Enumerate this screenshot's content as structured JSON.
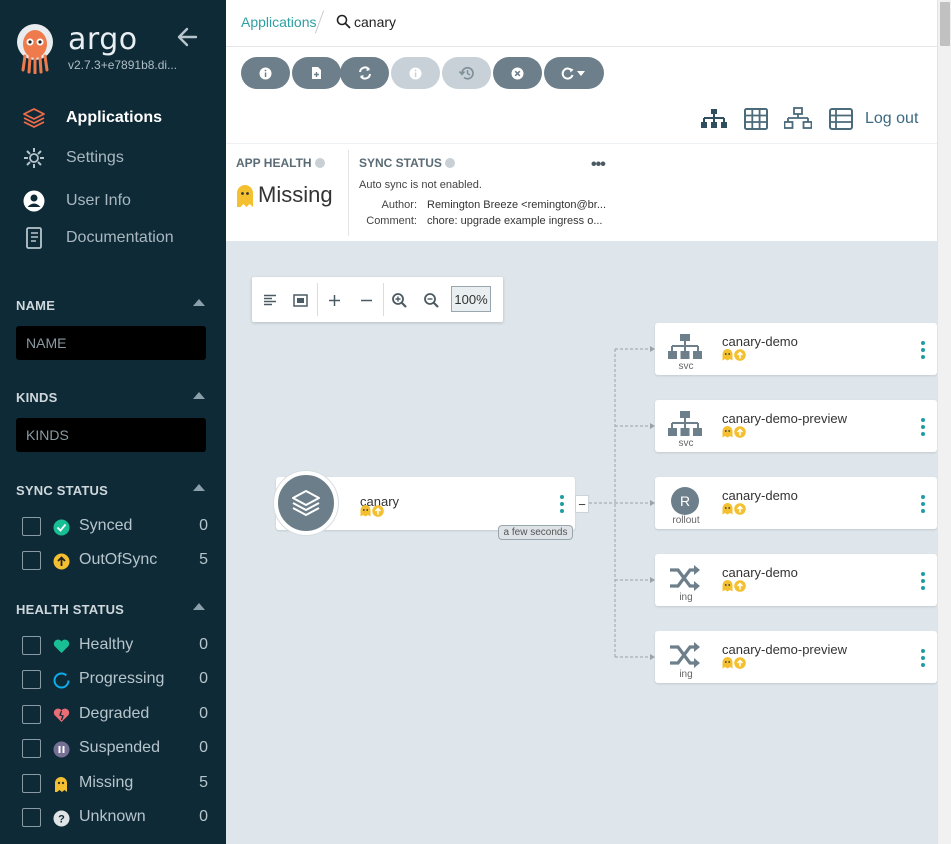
{
  "brand": {
    "name": "argo",
    "version": "v2.7.3+e7891b8.di...",
    "colors": {
      "sidebar_bg": "#0e2a36",
      "accent": "#2d9fa3",
      "missing": "#f4c030",
      "synced": "#18be94",
      "outofsync": "#f4c030"
    }
  },
  "nav": {
    "items": [
      {
        "label": "Applications",
        "icon": "layers-icon",
        "active": true
      },
      {
        "label": "Settings",
        "icon": "gear-icon"
      },
      {
        "label": "User Info",
        "icon": "user-icon"
      },
      {
        "label": "Documentation",
        "icon": "book-icon"
      }
    ]
  },
  "filters": {
    "name": {
      "title": "NAME",
      "placeholder": "NAME"
    },
    "kinds": {
      "title": "KINDS",
      "placeholder": "KINDS"
    },
    "sync_status": {
      "title": "SYNC STATUS",
      "items": [
        {
          "label": "Synced",
          "count": "0",
          "icon": "synced-check-icon"
        },
        {
          "label": "OutOfSync",
          "count": "5",
          "icon": "out-of-sync-arrow-icon"
        }
      ]
    },
    "health_status": {
      "title": "HEALTH STATUS",
      "items": [
        {
          "label": "Healthy",
          "count": "0",
          "icon": "heart-icon"
        },
        {
          "label": "Progressing",
          "count": "0",
          "icon": "progressing-circle-icon"
        },
        {
          "label": "Degraded",
          "count": "0",
          "icon": "broken-heart-icon"
        },
        {
          "label": "Suspended",
          "count": "0",
          "icon": "pause-icon"
        },
        {
          "label": "Missing",
          "count": "5",
          "icon": "ghost-icon"
        },
        {
          "label": "Unknown",
          "count": "0",
          "icon": "question-icon"
        }
      ]
    }
  },
  "breadcrumb": {
    "root": "Applications",
    "current": "canary"
  },
  "toolbar": {
    "buttons": [
      {
        "icon": "details-icon",
        "enabled": true
      },
      {
        "icon": "diff-icon",
        "enabled": true
      },
      {
        "icon": "sync-icon",
        "enabled": true
      },
      {
        "icon": "sync-status-icon",
        "enabled": false
      },
      {
        "icon": "history-icon",
        "enabled": false
      },
      {
        "icon": "delete-icon",
        "enabled": true
      },
      {
        "icon": "refresh-dropdown-icon",
        "enabled": true
      }
    ],
    "views": [
      "tree-view-icon",
      "pods-view-icon",
      "network-view-icon",
      "list-view-icon"
    ],
    "logout": "Log out"
  },
  "status": {
    "app_health": {
      "title": "APP HEALTH",
      "value": "Missing"
    },
    "sync_status": {
      "title": "SYNC STATUS",
      "message": "Auto sync is not enabled.",
      "author_label": "Author:",
      "author": "Remington Breeze <remington@br...",
      "comment_label": "Comment:",
      "comment": "chore: upgrade example ingress o..."
    }
  },
  "zoom": {
    "level": "100%"
  },
  "graph": {
    "app": {
      "name": "canary",
      "updated": "a few seconds",
      "collapse": "−"
    },
    "resources": [
      {
        "name": "canary-demo",
        "kind": "svc",
        "icon": "service-icon"
      },
      {
        "name": "canary-demo-preview",
        "kind": "svc",
        "icon": "service-icon"
      },
      {
        "name": "canary-demo",
        "kind": "rollout",
        "icon": "rollout-icon",
        "letter": "R"
      },
      {
        "name": "canary-demo",
        "kind": "ing",
        "icon": "ingress-icon"
      },
      {
        "name": "canary-demo-preview",
        "kind": "ing",
        "icon": "ingress-icon"
      }
    ]
  }
}
